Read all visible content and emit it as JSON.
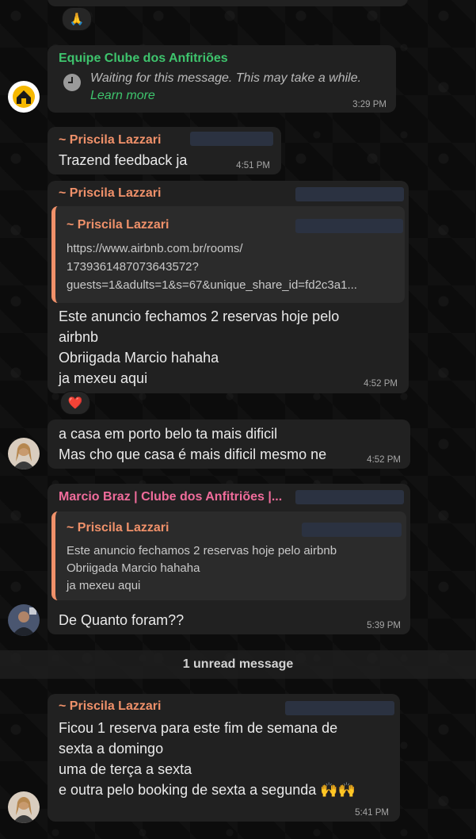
{
  "messages": {
    "m1": {
      "sender": "Equipe Clube dos Anfitriões",
      "waiting": "Waiting for this message. This may take a while.",
      "learn_more": "Learn more",
      "time": "3:29 PM"
    },
    "m2": {
      "sender": "~ Priscila Lazzari",
      "text": "Trazend feedback ja",
      "time": "4:51 PM"
    },
    "m3": {
      "sender": "~ Priscila Lazzari",
      "quote_sender": "~ Priscila Lazzari",
      "quote_lines": [
        "https://www.airbnb.com.br/rooms/",
        "1739361487073643572?",
        "guests=1&adults=1&s=67&unique_share_id=fd2c3a1..."
      ],
      "lines": [
        "Este anuncio fechamos 2 reservas hoje pelo",
        "airbnb",
        "Obriigada Marcio hahaha",
        "ja mexeu aqui"
      ],
      "time": "4:52 PM"
    },
    "m4": {
      "lines": [
        "a casa em porto belo ta mais dificil",
        "Mas cho que casa é mais dificil mesmo ne"
      ],
      "time": "4:52 PM"
    },
    "m5": {
      "sender": "Marcio Braz | Clube dos Anfitriões |...",
      "quote_sender": "~ Priscila Lazzari",
      "quote_lines": [
        "Este anuncio fechamos 2 reservas hoje pelo airbnb",
        "Obriigada Marcio hahaha",
        "ja mexeu aqui"
      ],
      "text": "De Quanto foram??",
      "time": "5:39 PM"
    },
    "m6": {
      "sender": "~ Priscila Lazzari",
      "lines": [
        "Ficou 1 reserva para este fim de semana de",
        "sexta a domingo",
        "uma de terça a sexta",
        "e outra pelo booking de sexta a segunda 🙌🙌"
      ],
      "time": "5:41 PM"
    }
  },
  "reactions": {
    "pray": "🙏",
    "heart": "❤️"
  },
  "divider": "1 unread message"
}
